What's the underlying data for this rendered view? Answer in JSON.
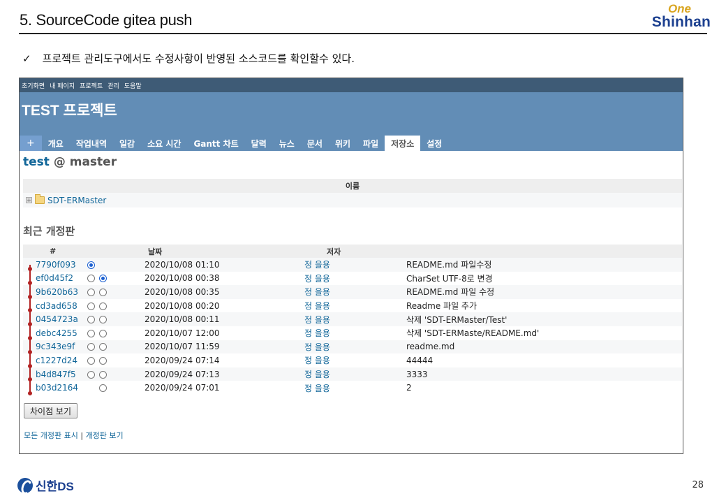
{
  "slide": {
    "title": "5. SourceCode gitea push",
    "bullet_mark": "✓",
    "bullet_text": "프로젝트 관리도구에서도 수정사항이 반영된 소스코드를 확인할수 있다.",
    "brand_top": "One",
    "brand_bottom": "Shinhan",
    "footer_brand": "신한DS",
    "page_number": "28"
  },
  "app": {
    "top_menu": [
      "초기화면",
      "내 페이지",
      "프로젝트",
      "관리",
      "도움말"
    ],
    "project_title": "TEST 프로젝트",
    "tabs": {
      "new": "+",
      "items": [
        "개요",
        "작업내역",
        "일감",
        "소요 시간",
        "Gantt 차트",
        "달력",
        "뉴스",
        "문서",
        "위키",
        "파일",
        "저장소",
        "설정"
      ],
      "selected": "저장소"
    },
    "repo": {
      "name": "test",
      "branch_sep": "@",
      "branch": "master"
    },
    "entries": {
      "header_name": "이름",
      "rows": [
        {
          "expander": "+",
          "name": "SDT-ERMaster"
        }
      ]
    },
    "revisions": {
      "section_title": "최근 개정판",
      "headers": {
        "id": "#",
        "date": "날짜",
        "author": "저자",
        "comment": ""
      },
      "rows": [
        {
          "id": "7790f093",
          "date": "2020/10/08 01:10",
          "author": "정 을용",
          "comment": "README.md 파일수정",
          "radio1": "checked",
          "radio2": "hidden"
        },
        {
          "id": "ef0d45f2",
          "date": "2020/10/08 00:38",
          "author": "정 을용",
          "comment": "CharSet UTF-8로 변경",
          "radio1": "off",
          "radio2": "checked"
        },
        {
          "id": "9b620b63",
          "date": "2020/10/08 00:35",
          "author": "정 을용",
          "comment": "README.md 파일 수정",
          "radio1": "off",
          "radio2": "off"
        },
        {
          "id": "cd3ad658",
          "date": "2020/10/08 00:20",
          "author": "정 을용",
          "comment": "Readme 파일 추가",
          "radio1": "off",
          "radio2": "off"
        },
        {
          "id": "0454723a",
          "date": "2020/10/08 00:11",
          "author": "정 을용",
          "comment": "삭제 'SDT-ERMaster/Test'",
          "radio1": "off",
          "radio2": "off"
        },
        {
          "id": "debc4255",
          "date": "2020/10/07 12:00",
          "author": "정 을용",
          "comment": "삭제 'SDT-ERMaste/README.md'",
          "radio1": "off",
          "radio2": "off"
        },
        {
          "id": "9c343e9f",
          "date": "2020/10/07 11:59",
          "author": "정 을용",
          "comment": "readme.md",
          "radio1": "off",
          "radio2": "off"
        },
        {
          "id": "c1227d24",
          "date": "2020/09/24 07:14",
          "author": "정 을용",
          "comment": "44444",
          "radio1": "off",
          "radio2": "off"
        },
        {
          "id": "b4d847f5",
          "date": "2020/09/24 07:13",
          "author": "정 을용",
          "comment": "3333",
          "radio1": "off",
          "radio2": "off"
        },
        {
          "id": "b03d2164",
          "date": "2020/09/24 07:01",
          "author": "정 을용",
          "comment": "2",
          "radio1": "hidden",
          "radio2": "off"
        }
      ]
    },
    "diff_button": "차이점 보기",
    "bottom_links": {
      "all": "모든 개정판 표시",
      "sep": "|",
      "view": "개정판 보기"
    }
  },
  "colors": {
    "header_bg": "#628db6",
    "top_menu_bg": "#3e5b76",
    "link": "#116699",
    "graph": "#b22222"
  }
}
